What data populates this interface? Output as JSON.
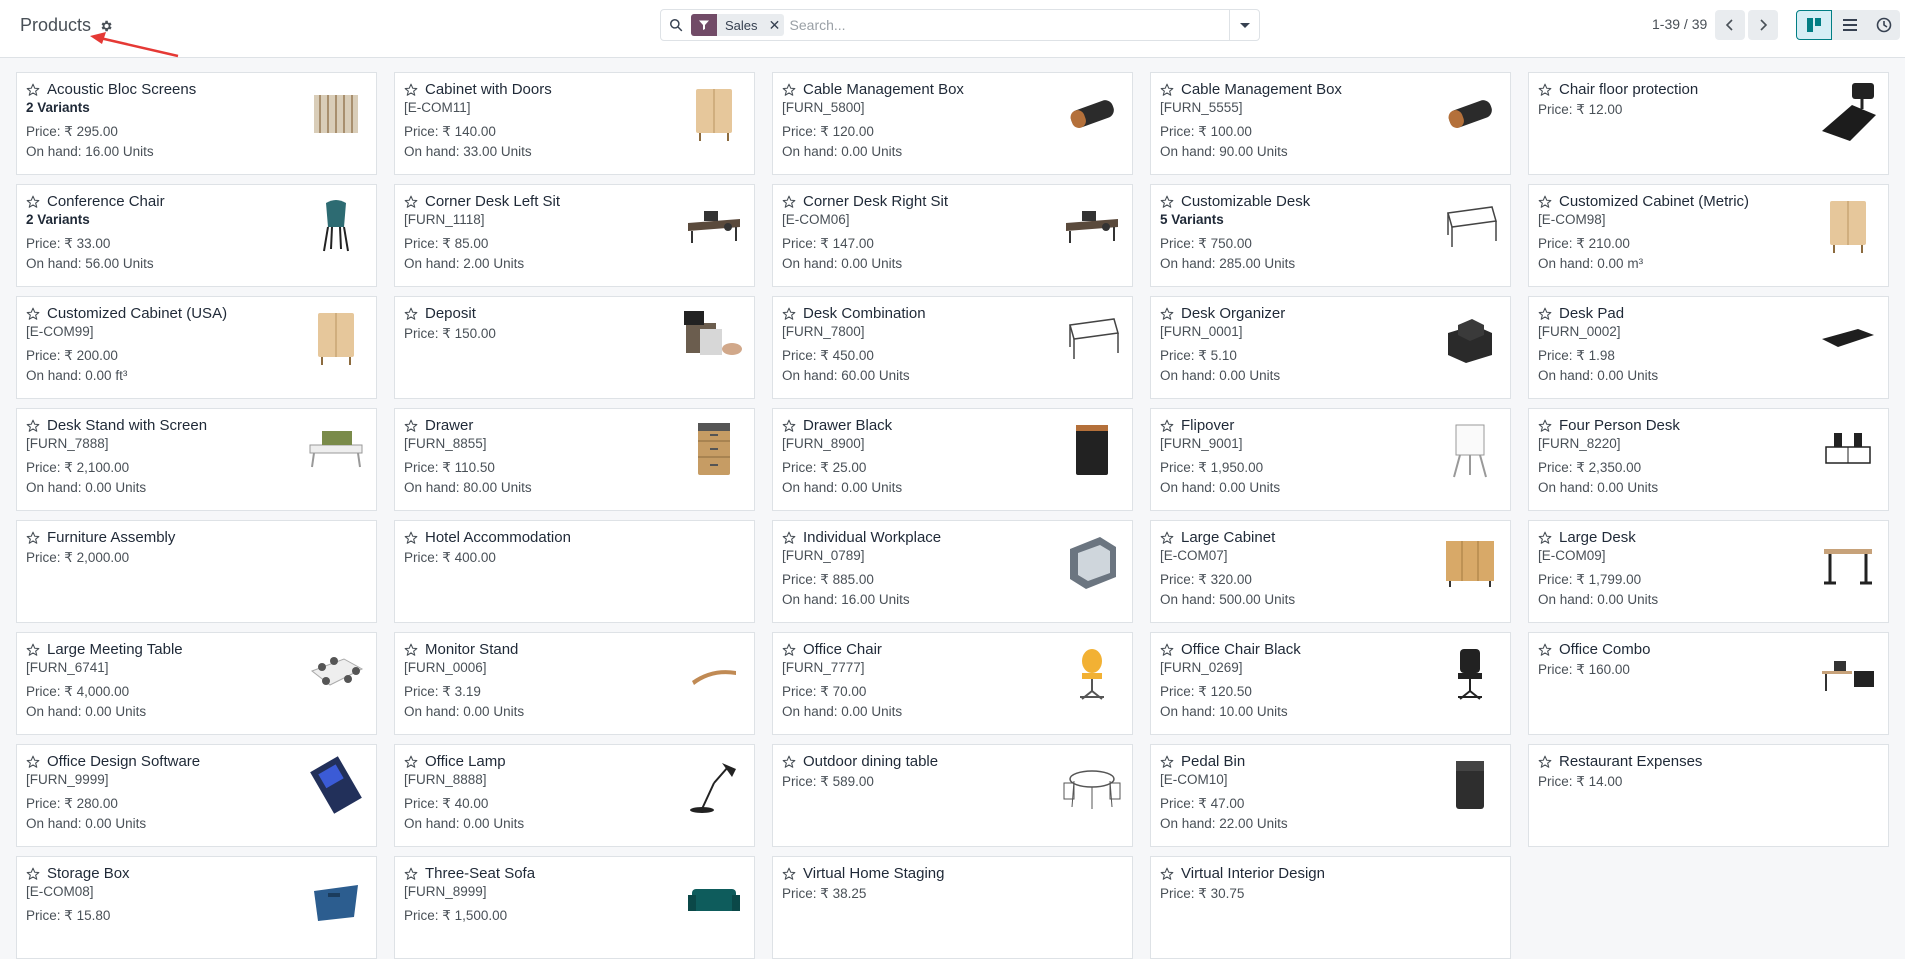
{
  "header": {
    "title": "Products",
    "search": {
      "facet_label": "Sales",
      "placeholder": "Search..."
    },
    "pager": "1-39 / 39"
  },
  "products": [
    {
      "name": "Acoustic Bloc Screens",
      "sub": "2 Variants",
      "variants": true,
      "price": "Price: ₹ 295.00",
      "onhand": "On hand: 16.00 Units",
      "icon": "screen"
    },
    {
      "name": "Cabinet with Doors",
      "sub": "[E-COM11]",
      "variants": false,
      "price": "Price: ₹ 140.00",
      "onhand": "On hand: 33.00 Units",
      "icon": "cabinet"
    },
    {
      "name": "Cable Management Box",
      "sub": "[FURN_5800]",
      "variants": false,
      "price": "Price: ₹ 120.00",
      "onhand": "On hand: 0.00 Units",
      "icon": "box"
    },
    {
      "name": "Cable Management Box",
      "sub": "[FURN_5555]",
      "variants": false,
      "price": "Price: ₹ 100.00",
      "onhand": "On hand: 90.00 Units",
      "icon": "box"
    },
    {
      "name": "Chair floor protection",
      "sub": "",
      "variants": false,
      "price": "Price: ₹ 12.00",
      "onhand": "",
      "icon": "mat"
    },
    {
      "name": "Conference Chair",
      "sub": "2 Variants",
      "variants": true,
      "price": "Price: ₹ 33.00",
      "onhand": "On hand: 56.00 Units",
      "icon": "chair"
    },
    {
      "name": "Corner Desk Left Sit",
      "sub": "[FURN_1118]",
      "variants": false,
      "price": "Price: ₹ 85.00",
      "onhand": "On hand: 2.00 Units",
      "icon": "desk"
    },
    {
      "name": "Corner Desk Right Sit",
      "sub": "[E-COM06]",
      "variants": false,
      "price": "Price: ₹ 147.00",
      "onhand": "On hand: 0.00 Units",
      "icon": "desk"
    },
    {
      "name": "Customizable Desk",
      "sub": "5 Variants",
      "variants": true,
      "price": "Price: ₹ 750.00",
      "onhand": "On hand: 285.00 Units",
      "icon": "table"
    },
    {
      "name": "Customized Cabinet (Metric)",
      "sub": "[E-COM98]",
      "variants": false,
      "price": "Price: ₹ 210.00",
      "onhand": "On hand: 0.00 m³",
      "icon": "cabinet"
    },
    {
      "name": "Customized Cabinet (USA)",
      "sub": "[E-COM99]",
      "variants": false,
      "price": "Price: ₹ 200.00",
      "onhand": "On hand: 0.00 ft³",
      "icon": "cabinet"
    },
    {
      "name": "Deposit",
      "sub": "",
      "variants": false,
      "price": "Price: ₹ 150.00",
      "onhand": "",
      "icon": "money"
    },
    {
      "name": "Desk Combination",
      "sub": "[FURN_7800]",
      "variants": false,
      "price": "Price: ₹ 450.00",
      "onhand": "On hand: 60.00 Units",
      "icon": "table"
    },
    {
      "name": "Desk Organizer",
      "sub": "[FURN_0001]",
      "variants": false,
      "price": "Price: ₹ 5.10",
      "onhand": "On hand: 0.00 Units",
      "icon": "organizer"
    },
    {
      "name": "Desk Pad",
      "sub": "[FURN_0002]",
      "variants": false,
      "price": "Price: ₹ 1.98",
      "onhand": "On hand: 0.00 Units",
      "icon": "pad"
    },
    {
      "name": "Desk Stand with Screen",
      "sub": "[FURN_7888]",
      "variants": false,
      "price": "Price: ₹ 2,100.00",
      "onhand": "On hand: 0.00 Units",
      "icon": "stand"
    },
    {
      "name": "Drawer",
      "sub": "[FURN_8855]",
      "variants": false,
      "price": "Price: ₹ 110.50",
      "onhand": "On hand: 80.00 Units",
      "icon": "drawer"
    },
    {
      "name": "Drawer Black",
      "sub": "[FURN_8900]",
      "variants": false,
      "price": "Price: ₹ 25.00",
      "onhand": "On hand: 0.00 Units",
      "icon": "drawerblack"
    },
    {
      "name": "Flipover",
      "sub": "[FURN_9001]",
      "variants": false,
      "price": "Price: ₹ 1,950.00",
      "onhand": "On hand: 0.00 Units",
      "icon": "flip"
    },
    {
      "name": "Four Person Desk",
      "sub": "[FURN_8220]",
      "variants": false,
      "price": "Price: ₹ 2,350.00",
      "onhand": "On hand: 0.00 Units",
      "icon": "fourdesk"
    },
    {
      "name": "Furniture Assembly",
      "sub": "",
      "variants": false,
      "price": "Price: ₹ 2,000.00",
      "onhand": "",
      "icon": ""
    },
    {
      "name": "Hotel Accommodation",
      "sub": "",
      "variants": false,
      "price": "Price: ₹ 400.00",
      "onhand": "",
      "icon": ""
    },
    {
      "name": "Individual Workplace",
      "sub": "[FURN_0789]",
      "variants": false,
      "price": "Price: ₹ 885.00",
      "onhand": "On hand: 16.00 Units",
      "icon": "workplace"
    },
    {
      "name": "Large Cabinet",
      "sub": "[E-COM07]",
      "variants": false,
      "price": "Price: ₹ 320.00",
      "onhand": "On hand: 500.00 Units",
      "icon": "bigcabinet"
    },
    {
      "name": "Large Desk",
      "sub": "[E-COM09]",
      "variants": false,
      "price": "Price: ₹ 1,799.00",
      "onhand": "On hand: 0.00 Units",
      "icon": "largedesk"
    },
    {
      "name": "Large Meeting Table",
      "sub": "[FURN_6741]",
      "variants": false,
      "price": "Price: ₹ 4,000.00",
      "onhand": "On hand: 0.00 Units",
      "icon": "meeting"
    },
    {
      "name": "Monitor Stand",
      "sub": "[FURN_0006]",
      "variants": false,
      "price": "Price: ₹ 3.19",
      "onhand": "On hand: 0.00 Units",
      "icon": "monitorstand"
    },
    {
      "name": "Office Chair",
      "sub": "[FURN_7777]",
      "variants": false,
      "price": "Price: ₹ 70.00",
      "onhand": "On hand: 0.00 Units",
      "icon": "officechair"
    },
    {
      "name": "Office Chair Black",
      "sub": "[FURN_0269]",
      "variants": false,
      "price": "Price: ₹ 120.50",
      "onhand": "On hand: 10.00 Units",
      "icon": "blackchair"
    },
    {
      "name": "Office Combo",
      "sub": "",
      "variants": false,
      "price": "Price: ₹ 160.00",
      "onhand": "",
      "icon": "combo"
    },
    {
      "name": "Office Design Software",
      "sub": "[FURN_9999]",
      "variants": false,
      "price": "Price: ₹ 280.00",
      "onhand": "On hand: 0.00 Units",
      "icon": "software"
    },
    {
      "name": "Office Lamp",
      "sub": "[FURN_8888]",
      "variants": false,
      "price": "Price: ₹ 40.00",
      "onhand": "On hand: 0.00 Units",
      "icon": "lamp"
    },
    {
      "name": "Outdoor dining table",
      "sub": "",
      "variants": false,
      "price": "Price: ₹ 589.00",
      "onhand": "",
      "icon": "dining"
    },
    {
      "name": "Pedal Bin",
      "sub": "[E-COM10]",
      "variants": false,
      "price": "Price: ₹ 47.00",
      "onhand": "On hand: 22.00 Units",
      "icon": "bin"
    },
    {
      "name": "Restaurant Expenses",
      "sub": "",
      "variants": false,
      "price": "Price: ₹ 14.00",
      "onhand": "",
      "icon": ""
    },
    {
      "name": "Storage Box",
      "sub": "[E-COM08]",
      "variants": false,
      "price": "Price: ₹ 15.80",
      "onhand": "",
      "icon": "storage"
    },
    {
      "name": "Three-Seat Sofa",
      "sub": "[FURN_8999]",
      "variants": false,
      "price": "Price: ₹ 1,500.00",
      "onhand": "",
      "icon": "sofa"
    },
    {
      "name": "Virtual Home Staging",
      "sub": "",
      "variants": false,
      "price": "Price: ₹ 38.25",
      "onhand": "",
      "icon": ""
    },
    {
      "name": "Virtual Interior Design",
      "sub": "",
      "variants": false,
      "price": "Price: ₹ 30.75",
      "onhand": "",
      "icon": ""
    }
  ],
  "colors": {
    "brand": "#714b67",
    "accent": "#017e84",
    "arrow": "#e53935"
  }
}
